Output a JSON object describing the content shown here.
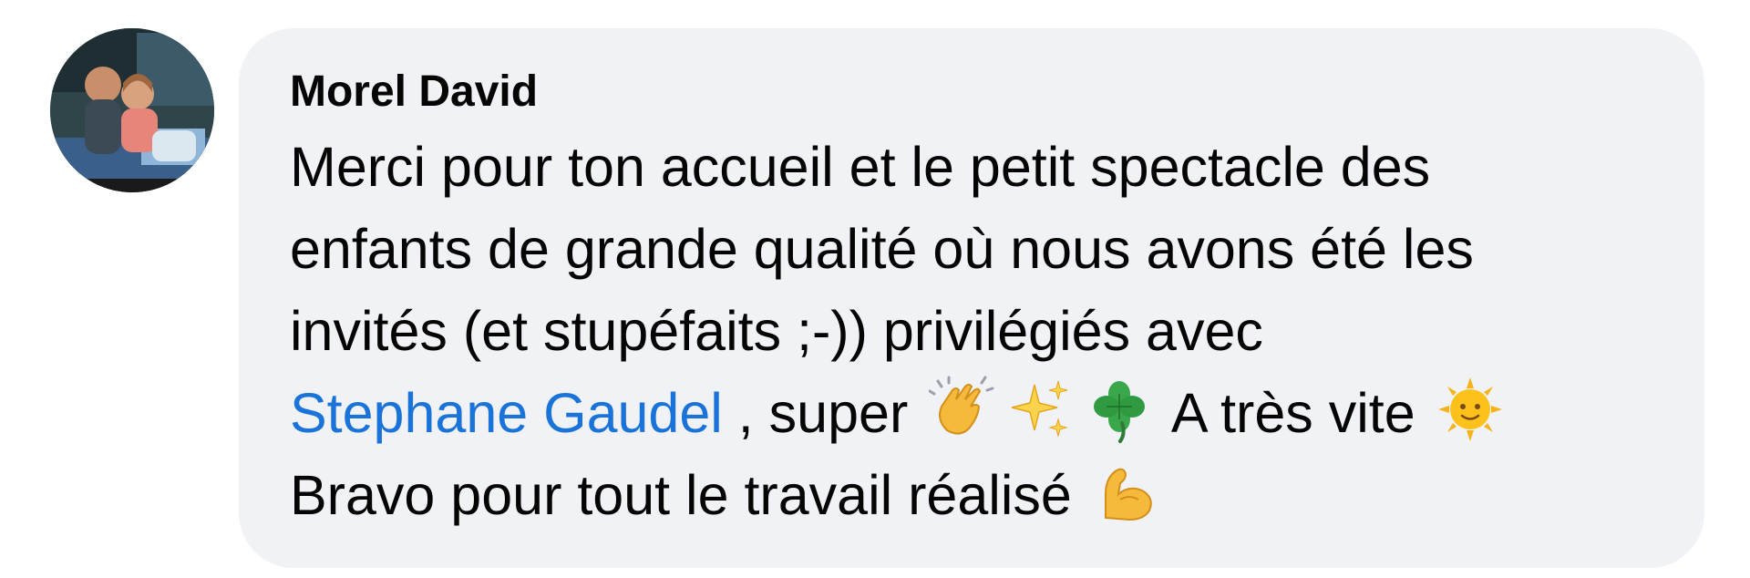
{
  "comment": {
    "author": "Morel David",
    "avatar_icon": "profile-photo-couple",
    "text": {
      "line1": "Merci pour ton accueil et le petit spectacle des",
      "line2": "enfants de grande qualité où nous avons été les",
      "line3": "invités (et stupéfaits ;-)) privilégiés avec",
      "mention": "Stephane Gaudel",
      "after_mention": " , super",
      "after_emojis": "A très vite",
      "line5": "Bravo pour tout le travail réalisé"
    },
    "emojis": [
      "clapping-hands-emoji",
      "sparkles-emoji",
      "four-leaf-clover-emoji",
      "sun-with-face-emoji",
      "flexed-biceps-emoji"
    ]
  },
  "colors": {
    "bubble_background": "#f0f2f5",
    "mention": "#1a73d9",
    "text": "#050505"
  }
}
